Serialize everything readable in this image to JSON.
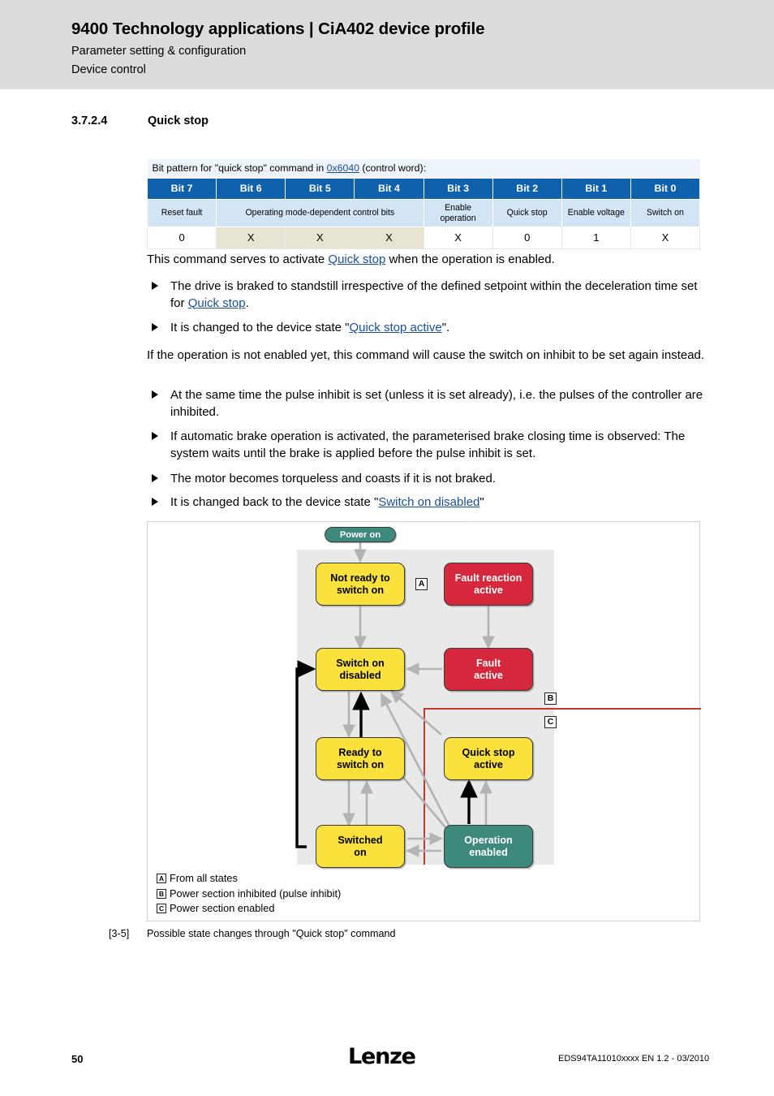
{
  "header": {
    "title": "9400 Technology applications | CiA402 device profile",
    "subtitle1": "Parameter setting & configuration",
    "subtitle2": "Device control"
  },
  "section": {
    "number": "3.7.2.4",
    "title": "Quick stop"
  },
  "bit_table": {
    "caption_prefix": "Bit pattern for \"quick stop\" command in ",
    "caption_link": "0x6040",
    "caption_suffix": " (control word):",
    "headers": [
      "Bit 7",
      "Bit 6",
      "Bit 5",
      "Bit 4",
      "Bit 3",
      "Bit 2",
      "Bit 1",
      "Bit 0"
    ],
    "descriptions": [
      "Reset fault",
      "Operating mode-dependent control bits",
      "Enable operation",
      "Quick stop",
      "Enable voltage",
      "Switch on"
    ],
    "values": [
      "0",
      "X",
      "X",
      "X",
      "X",
      "0",
      "1",
      "X"
    ]
  },
  "body": {
    "intro_a": "This command serves to activate ",
    "intro_link": "Quick stop",
    "intro_b": " when the operation is enabled.",
    "bullet1_a": "The drive is braked to standstill irrespective of the defined setpoint within the deceleration time set for ",
    "bullet1_link": "Quick stop",
    "bullet1_b": ".",
    "bullet2_a": "It is changed to the device state \"",
    "bullet2_link": "Quick stop active",
    "bullet2_b": "\".",
    "para2": "If the operation is not enabled yet, this command will cause the switch on inhibit to be set again instead.",
    "bullet3": "At the same time the pulse inhibit is set (unless it is set already), i.e. the pulses of the controller are inhibited.",
    "bullet4": "If automatic brake operation is activated, the parameterised brake closing time is observed: The system waits until the brake is applied before the pulse inhibit is set.",
    "bullet5": "The motor becomes torqueless and coasts if it is not braked.",
    "bullet6_a": "It is changed back to the device state \"",
    "bullet6_link": "Switch on disabled",
    "bullet6_b": "\""
  },
  "diagram": {
    "power_on": "Power on",
    "nodes": {
      "not_ready": "Not ready to\nswitch on",
      "fault_reaction": "Fault reaction\nactive",
      "switch_on_disabled": "Switch on\ndisabled",
      "fault_active": "Fault\nactive",
      "ready_to_switch_on": "Ready to\nswitch on",
      "quick_stop_active": "Quick stop\nactive",
      "switched_on": "Switched\non",
      "operation_enabled": "Operation\nenabled"
    },
    "markers": {
      "a": "A",
      "b": "B",
      "c": "C"
    },
    "legend": [
      {
        "marker": "A",
        "text": "From all states"
      },
      {
        "marker": "B",
        "text": "Power section inhibited (pulse inhibit)"
      },
      {
        "marker": "C",
        "text": "Power section enabled"
      }
    ],
    "colors": {
      "yellow": "#fbe13c",
      "red": "#d6283c",
      "teal": "#3d8a7d",
      "panel_gray": "#e9e9e9",
      "region_red": "#c0392b",
      "arrow_gray": "#b3b3b3",
      "arrow_black": "#000000"
    }
  },
  "figure_caption": {
    "number": "[3-5]",
    "text": "Possible state changes through \"Quick stop\" command"
  },
  "footer": {
    "page_number": "50",
    "logo": "Lenze",
    "doc_id": "EDS94TA11010xxxx EN 1.2 - 03/2010"
  }
}
